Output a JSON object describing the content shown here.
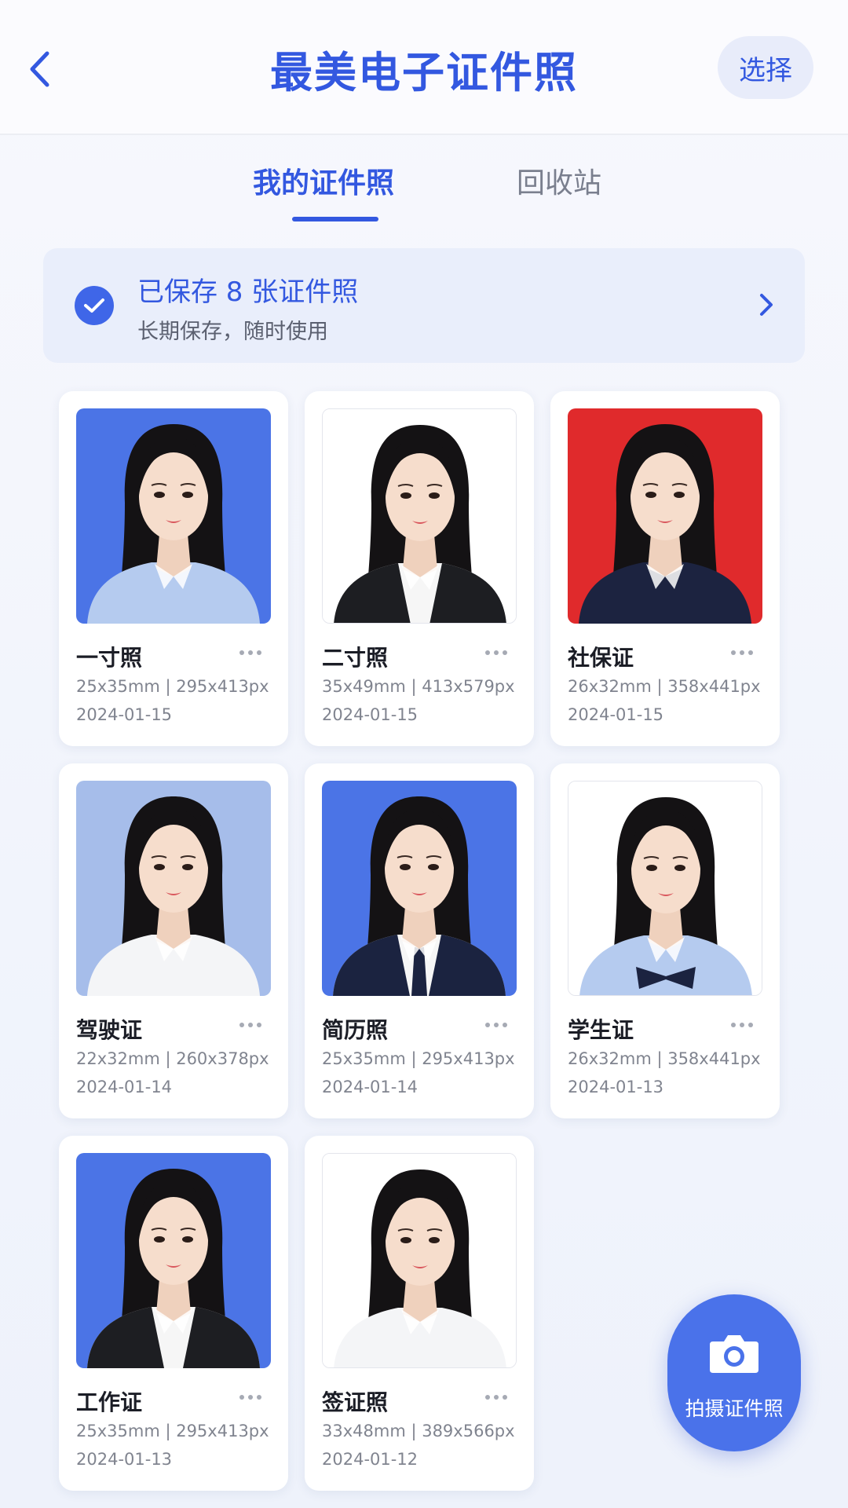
{
  "header": {
    "title": "最美电子证件照",
    "select_label": "选择"
  },
  "tabs": [
    {
      "label": "我的证件照",
      "active": true
    },
    {
      "label": "回收站",
      "active": false
    }
  ],
  "banner": {
    "title": "已保存 8 张证件照",
    "subtitle": "长期保存，随时使用"
  },
  "photos": [
    {
      "name": "一寸照",
      "spec": "25x35mm | 295x413px",
      "date": "2024-01-15",
      "background": "#4b74e6",
      "outfit": "light blue shirt"
    },
    {
      "name": "二寸照",
      "spec": "35x49mm | 413x579px",
      "date": "2024-01-15",
      "background": "#ffffff",
      "outfit": "black suit"
    },
    {
      "name": "社保证",
      "spec": "26x32mm | 358x441px",
      "date": "2024-01-15",
      "background": "#e02a2c",
      "outfit": "navy shirt"
    },
    {
      "name": "驾驶证",
      "spec": "22x32mm | 260x378px",
      "date": "2024-01-14",
      "background": "#a6bdea",
      "outfit": "white shirt"
    },
    {
      "name": "简历照",
      "spec": "25x35mm | 295x413px",
      "date": "2024-01-14",
      "background": "#4b74e6",
      "outfit": "navy suit with tie"
    },
    {
      "name": "学生证",
      "spec": "26x32mm | 358x441px",
      "date": "2024-01-13",
      "background": "#ffffff",
      "outfit": "light blue shirt with bow"
    },
    {
      "name": "工作证",
      "spec": "25x35mm | 295x413px",
      "date": "2024-01-13",
      "background": "#4b74e6",
      "outfit": "black suit"
    },
    {
      "name": "签证照",
      "spec": "33x48mm | 389x566px",
      "date": "2024-01-12",
      "background": "#ffffff",
      "outfit": "white shirt"
    }
  ],
  "fab": {
    "label": "拍摄证件照",
    "icon": "camera-icon"
  },
  "colors": {
    "accent": "#3358e0",
    "fab": "#4a72ea",
    "banner_bg": "#e9eefb"
  },
  "icons": {
    "back": "chevron-left-icon",
    "check": "check-circle-icon",
    "forward": "chevron-right-icon",
    "more": "more-dots-icon"
  }
}
